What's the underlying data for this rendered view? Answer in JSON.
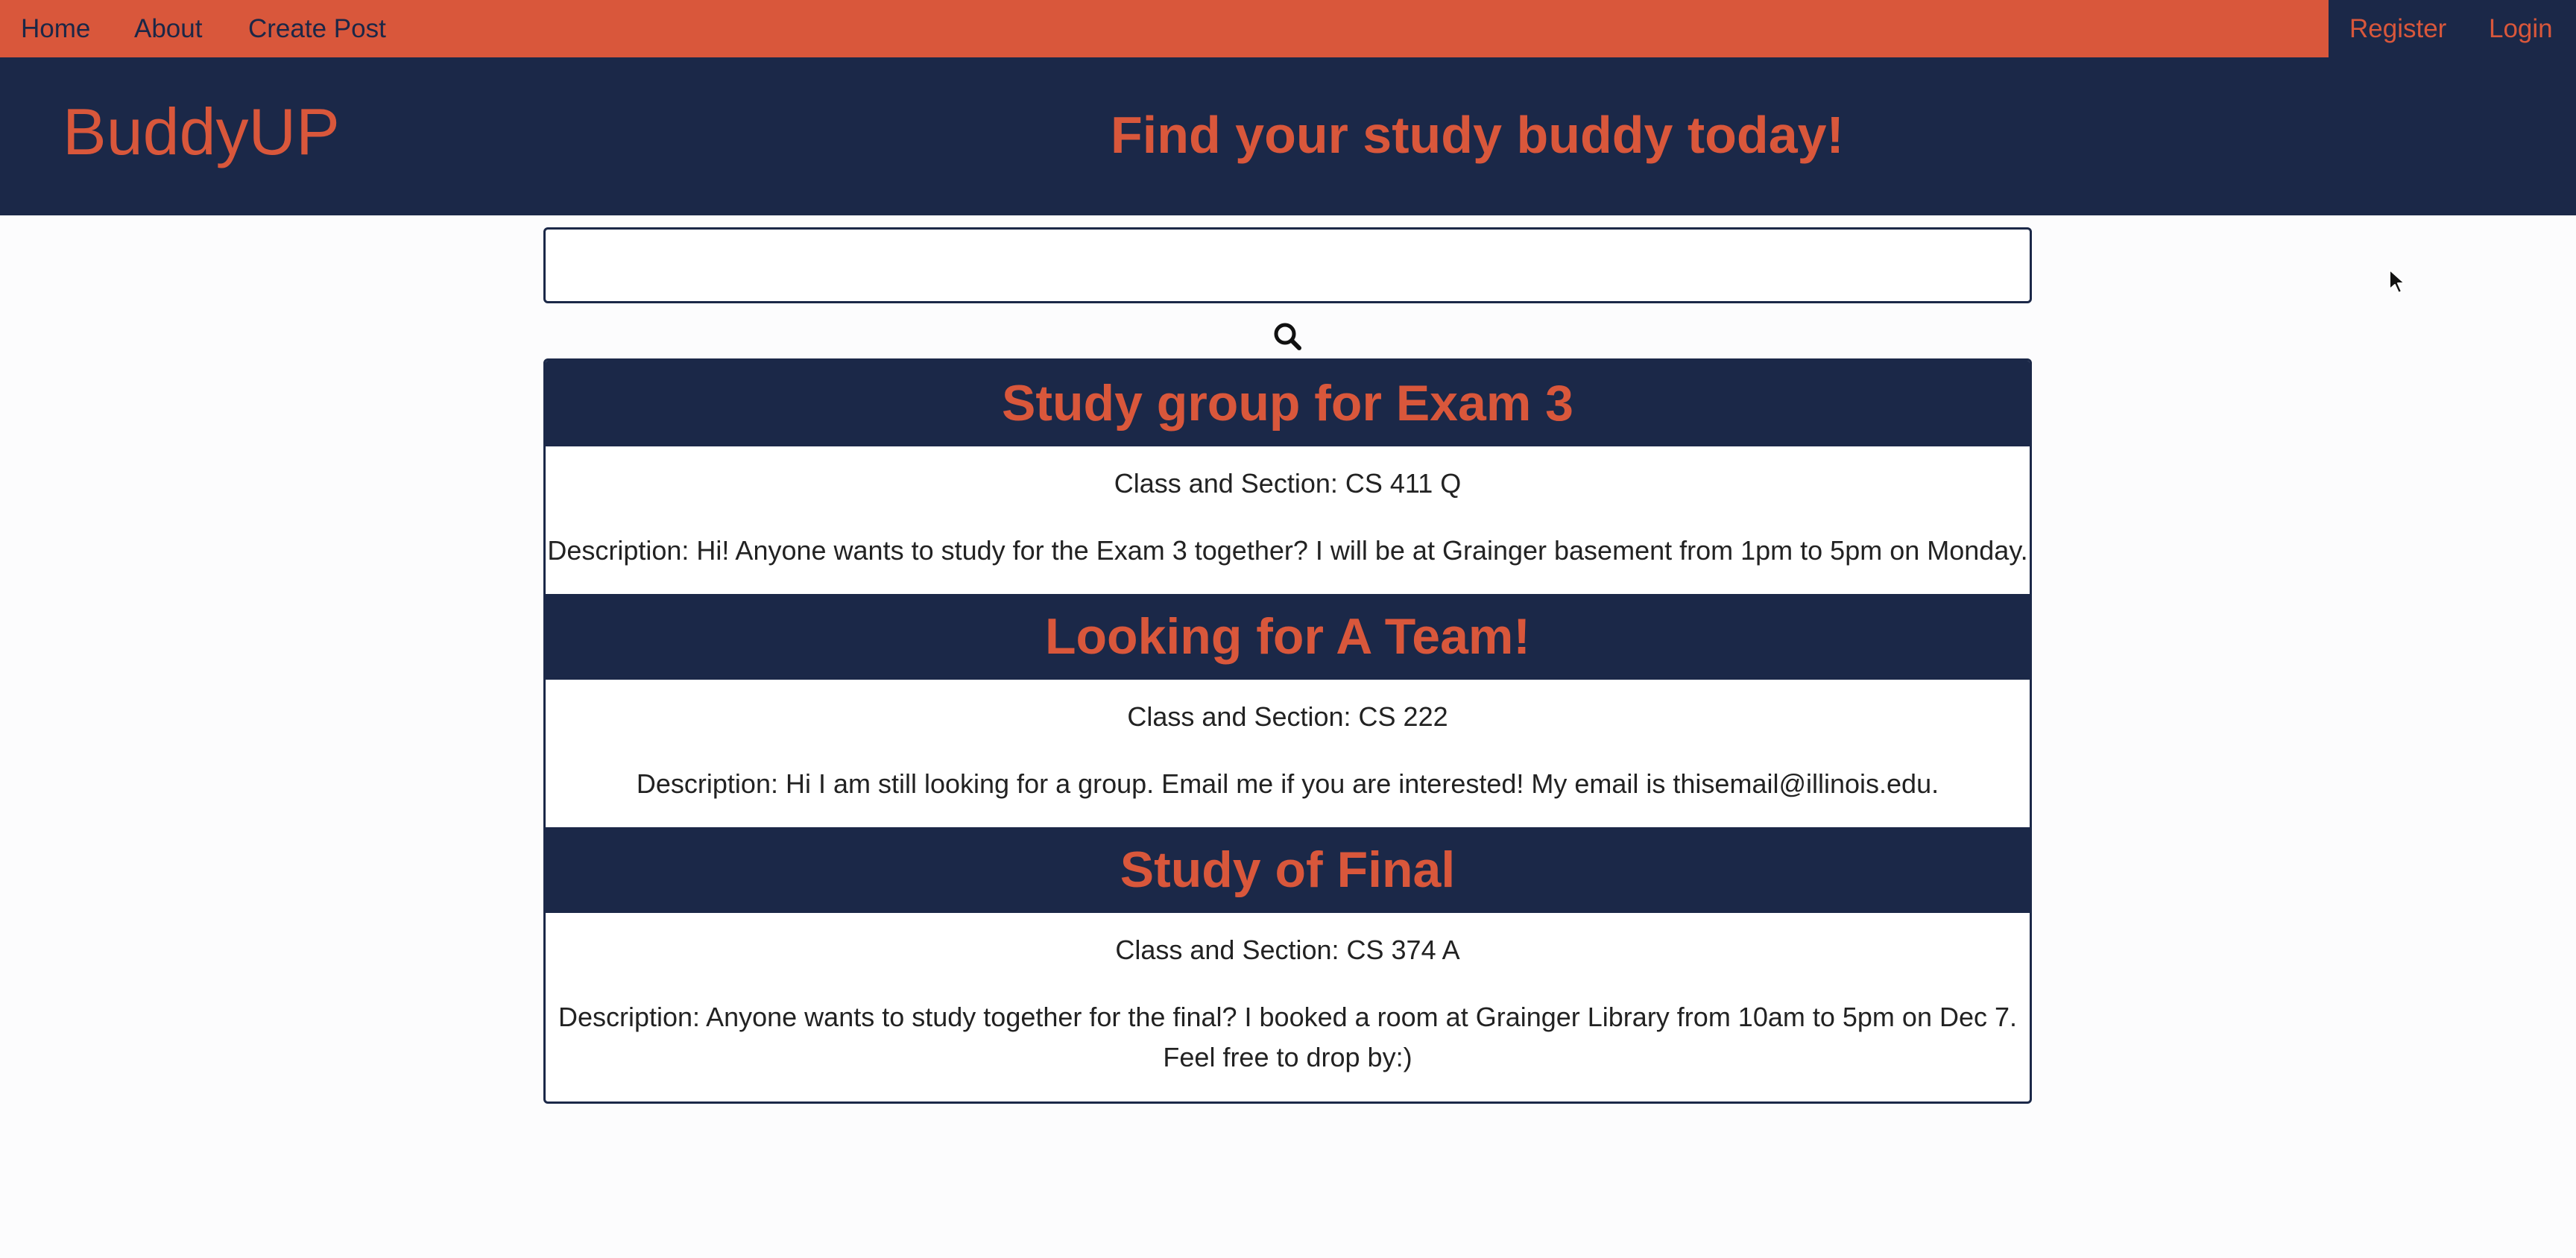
{
  "nav": {
    "home": "Home",
    "about": "About",
    "create_post": "Create Post",
    "register": "Register",
    "login": "Login"
  },
  "banner": {
    "brand": "BuddyUP",
    "tagline": "Find your study buddy today!"
  },
  "search": {
    "value": "",
    "placeholder": "",
    "icon": "search-icon"
  },
  "posts": [
    {
      "title": "Study group for Exam 3",
      "class_section": "Class and Section: CS 411 Q",
      "description": "Description: Hi! Anyone wants to study for the Exam 3 together? I will be at Grainger basement from 1pm to 5pm on Monday."
    },
    {
      "title": "Looking for A Team!",
      "class_section": "Class and Section: CS 222",
      "description": "Description: Hi I am still looking for a group. Email me if you are interested! My email is thisemail@illinois.edu."
    },
    {
      "title": "Study of Final",
      "class_section": "Class and Section: CS 374 A",
      "description": "Description: Anyone wants to study together for the final? I booked a room at Grainger Library from 10am to 5pm on Dec 7. Feel free to drop by:)"
    }
  ],
  "colors": {
    "accent": "#d9573b",
    "navy": "#1b2848",
    "background": "#fcfcfd"
  }
}
